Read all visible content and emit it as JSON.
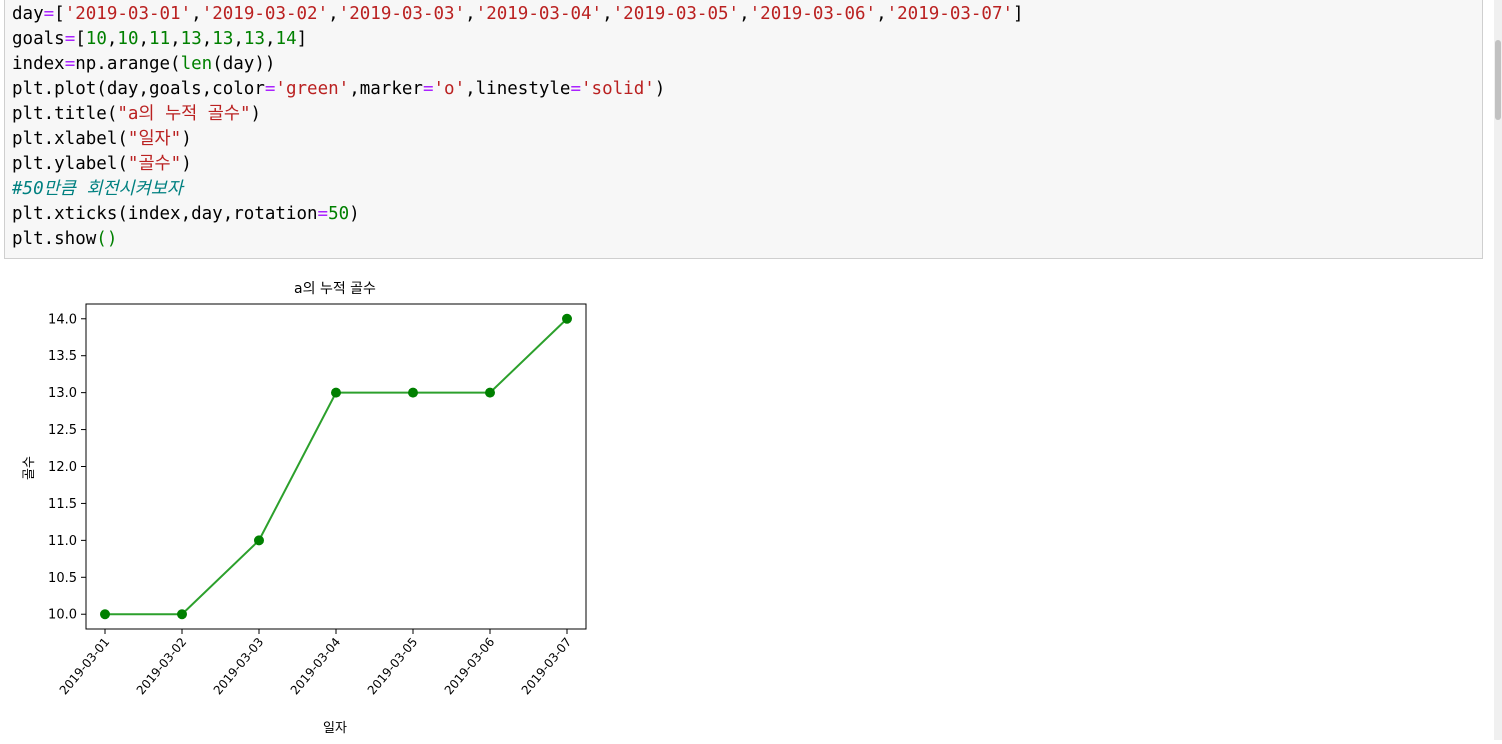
{
  "code_lines": [
    [
      [
        "day",
        ""
      ],
      [
        "=",
        "op"
      ],
      [
        "[",
        ""
      ],
      [
        "'2019-03-01'",
        "str"
      ],
      [
        ",",
        ""
      ],
      [
        "'2019-03-02'",
        "str"
      ],
      [
        ",",
        ""
      ],
      [
        "'2019-03-03'",
        "str"
      ],
      [
        ",",
        ""
      ],
      [
        "'2019-03-04'",
        "str"
      ],
      [
        ",",
        ""
      ],
      [
        "'2019-03-05'",
        "str"
      ],
      [
        ",",
        ""
      ],
      [
        "'2019-03-06'",
        "str"
      ],
      [
        ",",
        ""
      ],
      [
        "'2019-03-07'",
        "str"
      ],
      [
        "]",
        ""
      ]
    ],
    [
      [
        "goals",
        ""
      ],
      [
        "=",
        "op"
      ],
      [
        "[",
        ""
      ],
      [
        "10",
        "num"
      ],
      [
        ",",
        ""
      ],
      [
        "10",
        "num"
      ],
      [
        ",",
        ""
      ],
      [
        "11",
        "num"
      ],
      [
        ",",
        ""
      ],
      [
        "13",
        "num"
      ],
      [
        ",",
        ""
      ],
      [
        "13",
        "num"
      ],
      [
        ",",
        ""
      ],
      [
        "13",
        "num"
      ],
      [
        ",",
        ""
      ],
      [
        "14",
        "num"
      ],
      [
        "]",
        ""
      ]
    ],
    [
      [
        "index",
        ""
      ],
      [
        "=",
        "op"
      ],
      [
        "np.arange(",
        ""
      ],
      [
        "len",
        "fn"
      ],
      [
        "(day))",
        ""
      ]
    ],
    [
      [
        "plt.plot(day,goals,color",
        ""
      ],
      [
        "=",
        "op"
      ],
      [
        "'green'",
        "str"
      ],
      [
        ",marker",
        ""
      ],
      [
        "=",
        "op"
      ],
      [
        "'o'",
        "str"
      ],
      [
        ",linestyle",
        ""
      ],
      [
        "=",
        "op"
      ],
      [
        "'solid'",
        "str"
      ],
      [
        ")",
        ""
      ]
    ],
    [
      [
        "plt.title(",
        ""
      ],
      [
        "\"a의 누적 골수\"",
        "str"
      ],
      [
        ")",
        ""
      ]
    ],
    [
      [
        "plt.xlabel(",
        ""
      ],
      [
        "\"일자\"",
        "str"
      ],
      [
        ")",
        ""
      ]
    ],
    [
      [
        "plt.ylabel(",
        ""
      ],
      [
        "\"골수\"",
        "str"
      ],
      [
        ")",
        ""
      ]
    ],
    [
      [
        "#50만큼 회전시켜보자",
        "cmt"
      ]
    ],
    [
      [
        "plt.xticks(index,day,rotation",
        ""
      ],
      [
        "=",
        "op"
      ],
      [
        "50",
        "num"
      ],
      [
        ")",
        ""
      ]
    ],
    [
      [
        "plt.show",
        ""
      ],
      [
        "()",
        "fn"
      ]
    ]
  ],
  "colors": {
    "line": "#2ca02c",
    "marker": "#008000"
  },
  "chart_data": {
    "type": "line",
    "title": "a의 누적 골수",
    "xlabel": "일자",
    "ylabel": "골수",
    "categories": [
      "2019-03-01",
      "2019-03-02",
      "2019-03-03",
      "2019-03-04",
      "2019-03-05",
      "2019-03-06",
      "2019-03-07"
    ],
    "series": [
      {
        "values": [
          10,
          10,
          11,
          13,
          13,
          13,
          14
        ]
      }
    ],
    "ylim": [
      9.8,
      14.2
    ],
    "yticks": [
      "10.0",
      "10.5",
      "11.0",
      "11.5",
      "12.0",
      "12.5",
      "13.0",
      "13.5",
      "14.0"
    ],
    "ytick_values": [
      10.0,
      10.5,
      11.0,
      11.5,
      12.0,
      12.5,
      13.0,
      13.5,
      14.0
    ],
    "xtick_rotation": 50,
    "grid": false
  }
}
